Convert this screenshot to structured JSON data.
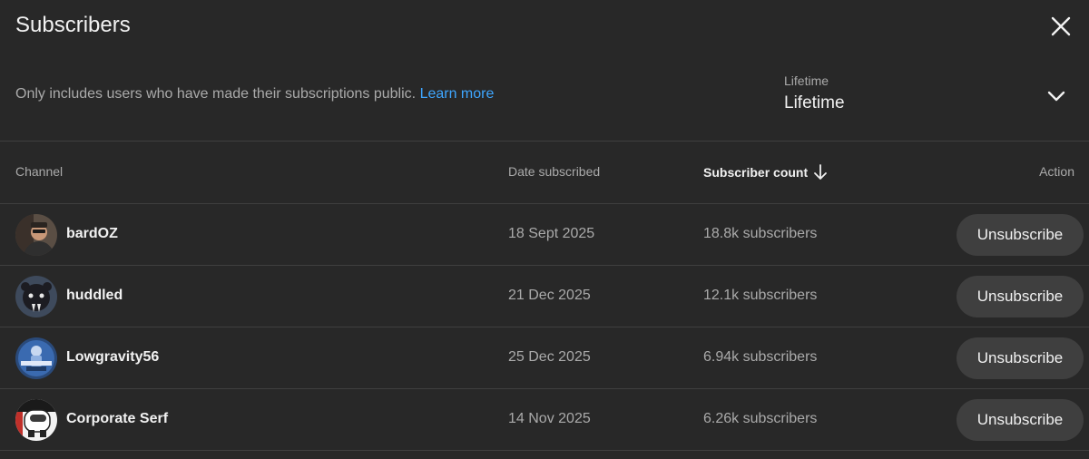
{
  "header": {
    "title": "Subscribers",
    "close_icon": "close-icon"
  },
  "notice": {
    "text": "Only includes users who have made their subscriptions public.",
    "link_text": "Learn more"
  },
  "filter": {
    "label": "Lifetime",
    "selected": "Lifetime",
    "icon": "chevron-down-icon"
  },
  "table": {
    "columns": {
      "channel": "Channel",
      "date": "Date subscribed",
      "count": "Subscriber count",
      "action": "Action"
    },
    "sort_icon": "arrow-down-icon",
    "rows": [
      {
        "name": "bardOZ",
        "date": "18 Sept 2025",
        "count": "18.8k subscribers",
        "action": "Unsubscribe"
      },
      {
        "name": "huddled",
        "date": "21 Dec 2025",
        "count": "12.1k subscribers",
        "action": "Unsubscribe"
      },
      {
        "name": "Lowgravity56",
        "date": "25 Dec 2025",
        "count": "6.94k subscribers",
        "action": "Unsubscribe"
      },
      {
        "name": "Corporate Serf",
        "date": "14 Nov 2025",
        "count": "6.26k subscribers",
        "action": "Unsubscribe"
      }
    ]
  },
  "colors": {
    "background": "#282828",
    "link": "#3ea6ff",
    "button": "#3f3f3f",
    "divider": "#3f3f3f",
    "secondary_text": "#aaaaaa"
  }
}
